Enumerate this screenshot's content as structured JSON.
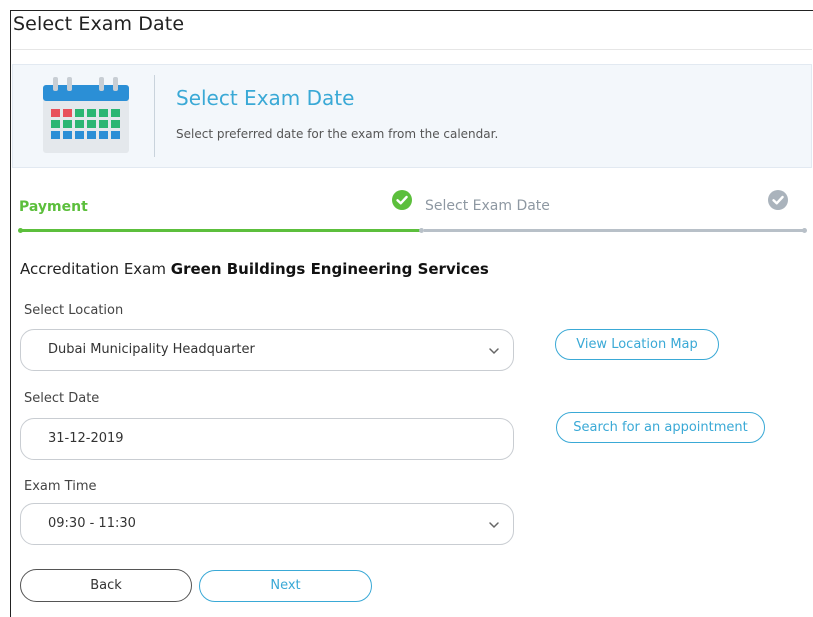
{
  "page": {
    "title": "Select Exam Date"
  },
  "info_box": {
    "icon": "calendar-icon",
    "title": "Select Exam Date",
    "subtitle": "Select preferred date for the exam from the calendar."
  },
  "steps": [
    {
      "label": "Payment",
      "state": "completed",
      "color": "#5cbf3c"
    },
    {
      "label": "Select Exam Date",
      "state": "current",
      "color": "#8e98a2"
    }
  ],
  "exam": {
    "prefix": "Accreditation Exam",
    "name": "Green Buildings Engineering Services"
  },
  "location": {
    "label": "Select Location",
    "value": "Dubai Municipality Headquarter",
    "map_button": "View Location Map"
  },
  "date": {
    "label": "Select Date",
    "value": "31-12-2019",
    "search_button": "Search for an appointment"
  },
  "time": {
    "label": "Exam Time",
    "value": "09:30 - 11:30"
  },
  "actions": {
    "back": "Back",
    "next": "Next"
  },
  "colors": {
    "accent": "#3aa9d6",
    "success": "#5cbf3c",
    "muted": "#b8c0c8"
  }
}
